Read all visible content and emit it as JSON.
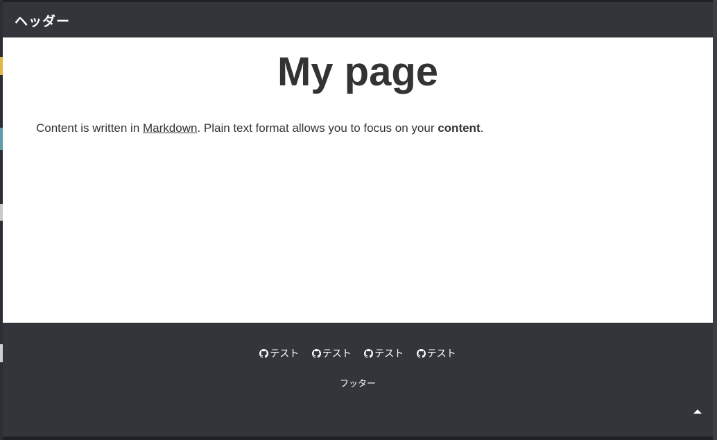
{
  "header": {
    "title": "ヘッダー"
  },
  "main": {
    "heading": "My page",
    "paragraph": {
      "before_link": "Content is written in ",
      "link_text": "Markdown",
      "middle": ". Plain text format allows you to focus on your ",
      "bold": "content",
      "after": "."
    }
  },
  "footer": {
    "links": [
      {
        "icon": "github-icon",
        "label": "テスト"
      },
      {
        "icon": "github-icon",
        "label": "テスト"
      },
      {
        "icon": "github-icon",
        "label": "テスト"
      },
      {
        "icon": "github-icon",
        "label": "テスト"
      }
    ],
    "text": "フッター",
    "scroll_top_icon": "triangle-up-icon"
  },
  "colors": {
    "header_bg": "#32363b",
    "footer_bg": "#32363b",
    "text": "#333333",
    "background": "#ffffff"
  }
}
